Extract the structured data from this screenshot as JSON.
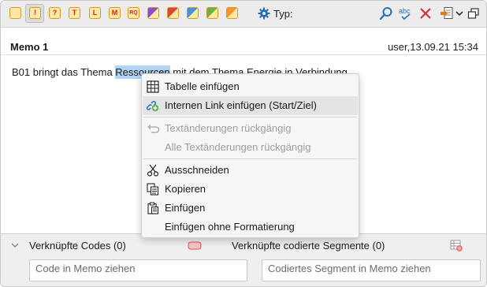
{
  "toolbar": {
    "quick_codes": [
      "!",
      "?",
      "T",
      "L",
      "M",
      "RQ"
    ],
    "typ_label": "Typ:",
    "icons": [
      "search-icon",
      "spellcheck-icon",
      "close-icon",
      "export-icon",
      "dropdown-icon",
      "detach-icon"
    ]
  },
  "memo": {
    "title": "Memo 1",
    "meta": "user,13.09.21 15:34",
    "text_before": "B01 bringt das Thema ",
    "text_selected": "Ressourcen",
    "text_after": " mit dem Thema Energie in Verbindung."
  },
  "context_menu": {
    "items": [
      {
        "label": "Tabelle einfügen",
        "icon": "table-icon",
        "enabled": true
      },
      {
        "label": "Internen Link einfügen (Start/Ziel)",
        "icon": "internal-link-icon",
        "enabled": true
      },
      {
        "label": "Textänderungen rückgängig",
        "icon": "undo-icon",
        "enabled": false
      },
      {
        "label": "Alle Textänderungen rückgängig",
        "icon": "",
        "enabled": false
      },
      {
        "label": "Ausschneiden",
        "icon": "scissors-icon",
        "enabled": true
      },
      {
        "label": "Kopieren",
        "icon": "copy-icon",
        "enabled": true
      },
      {
        "label": "Einfügen",
        "icon": "paste-icon",
        "enabled": true
      },
      {
        "label": "Einfügen ohne Formatierung",
        "icon": "",
        "enabled": true
      }
    ]
  },
  "bottom": {
    "codes_label": "Verknüpfte Codes (0)",
    "codes_placeholder": "Code in Memo ziehen",
    "segments_label": "Verknüpfte codierte Segmente (0)",
    "segments_placeholder": "Codiertes Segment in Memo ziehen"
  },
  "colors": {
    "selection": "#b3d3f5",
    "accent_blue": "#2a6fb6",
    "close_red": "#d32f2f",
    "memo_yellow": "#fde8a6"
  }
}
